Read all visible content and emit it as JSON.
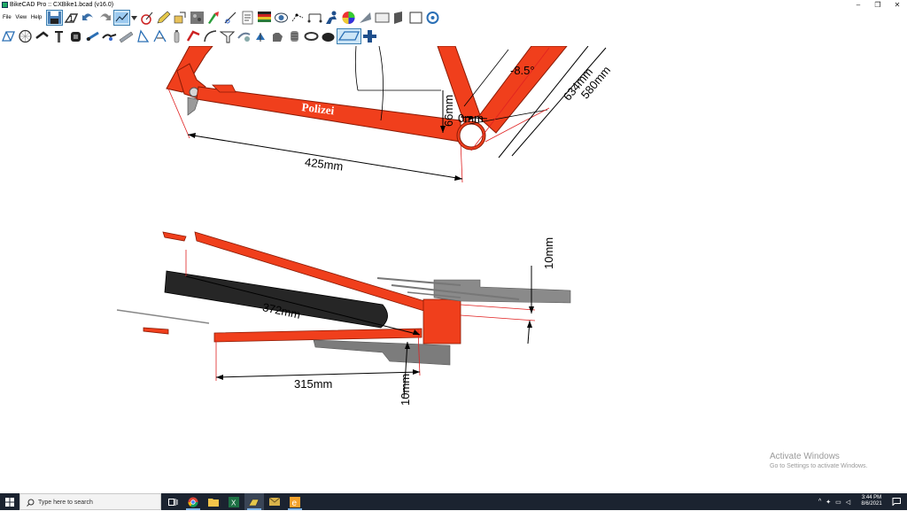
{
  "window": {
    "title": "BikeCAD Pro :: CXBike1.bcad (v16.0)",
    "controls": {
      "minimize": "–",
      "maximize": "❐",
      "close": "✕"
    }
  },
  "menu": {
    "file": "File",
    "view": "View",
    "help": "Help"
  },
  "toolbar_row1": [
    "save-icon",
    "bike-frame-icon",
    "undo-icon",
    "redo-icon",
    "graph-icon",
    "dropdown-icon",
    "brake-icon",
    "pencil-icon",
    "crop-icon",
    "texture-icon",
    "paint-icon",
    "measure-icon",
    "notes-icon",
    "flag-icon",
    "camera-icon",
    "dots-icon",
    "dimensions-icon",
    "rider-icon",
    "color-wheel-icon",
    "fold-icon",
    "screen-icon",
    "tilt-icon",
    "square-icon",
    "zoom-icon"
  ],
  "toolbar_row2": [
    "frame-icon",
    "wheel-icon",
    "stem-icon",
    "seatpost-icon",
    "tire-icon",
    "crank-icon",
    "pedal-icon",
    "tube-icon",
    "fork-icon",
    "fork2-icon",
    "bottle-icon",
    "rack-icon",
    "fender-icon",
    "seat-icon",
    "lock-icon",
    "light-icon",
    "hand-icon",
    "grip-icon",
    "chain-icon",
    "pannier-icon",
    "dimension-tool-icon",
    "add-icon"
  ],
  "drawing": {
    "brand": "Polizei",
    "dims": {
      "chainstay": "425mm",
      "bb_drop": "66mm",
      "bb_offset": "0mm",
      "angle": "-8.5°",
      "seat_tube_ct": "634mm",
      "seat_tube_cc": "580mm",
      "stay_length": "372mm",
      "stay_x": "315mm",
      "offset_top": "10mm",
      "offset_bottom": "10mm"
    }
  },
  "watermark": {
    "line1": "Activate Windows",
    "line2": "Go to Settings to activate Windows."
  },
  "taskbar": {
    "search_placeholder": "Type here to search",
    "time": "3:44 PM",
    "date": "8/6/2021"
  },
  "colors": {
    "frame": "#f03f1c",
    "taskbar": "#1b2330",
    "dim_line": "#e02020"
  }
}
